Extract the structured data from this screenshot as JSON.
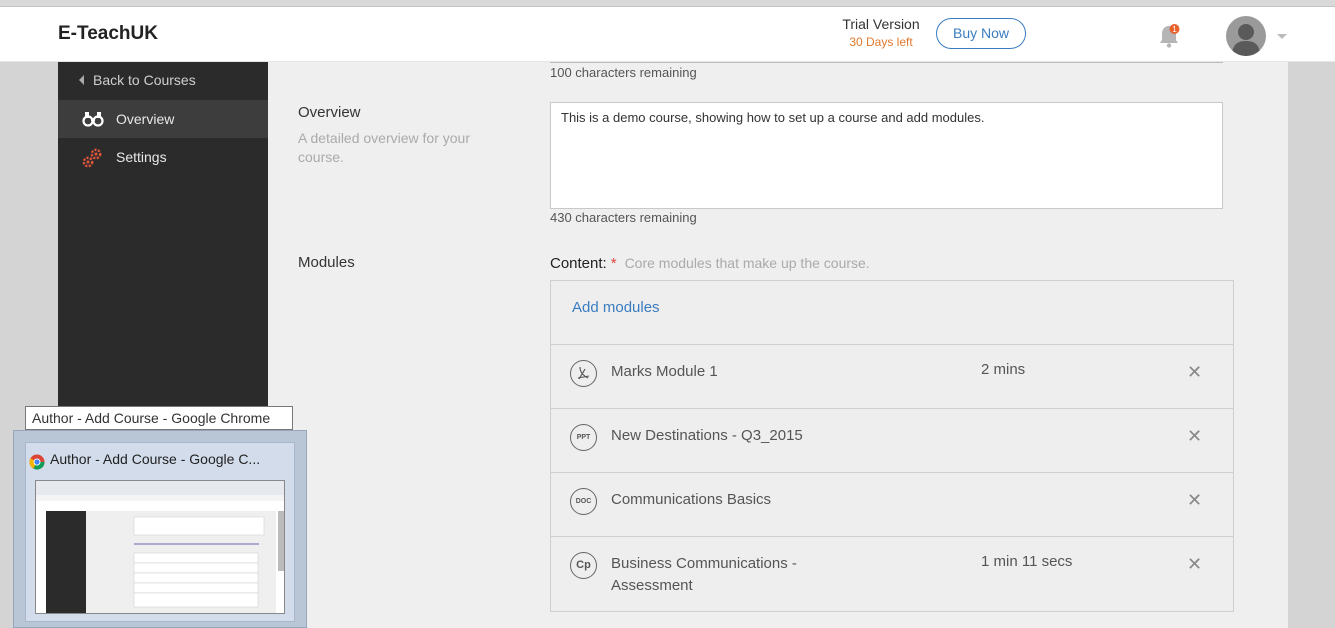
{
  "header": {
    "brand": "E-TeachUK",
    "trial_title": "Trial Version",
    "trial_days": "30 Days left",
    "buy_label": "Buy Now",
    "notification_count": "1"
  },
  "sidebar": {
    "back_label": "Back to Courses",
    "items": [
      {
        "label": "Overview",
        "icon": "binoculars-icon"
      },
      {
        "label": "Settings",
        "icon": "gears-icon"
      }
    ]
  },
  "form": {
    "title_remaining": "100 characters remaining",
    "overview_label": "Overview",
    "overview_desc": "A detailed overview for your course.",
    "overview_value": "This is a demo course, showing how to set up a course and add modules.",
    "overview_remaining": "430 characters remaining",
    "modules_label": "Modules",
    "content_label": "Content:",
    "content_required": "*",
    "content_hint": "Core modules that make up the course.",
    "add_modules": "Add modules",
    "modules": [
      {
        "icon_text": "",
        "icon": "pdf-icon",
        "name": "Marks Module 1",
        "duration": "2 mins"
      },
      {
        "icon_text": "PPT",
        "icon": "ppt-icon",
        "name": "New Destinations - Q3_2015",
        "duration": ""
      },
      {
        "icon_text": "DOC",
        "icon": "doc-icon",
        "name": "Communications Basics",
        "duration": ""
      },
      {
        "icon_text": "Cp",
        "icon": "captivate-icon",
        "name": "Business Communications - Assessment",
        "duration": "1 min 11 secs"
      }
    ],
    "remove_symbol": "✕"
  },
  "taskbar": {
    "tooltip": "Author - Add Course - Google Chrome",
    "thumb_title": "Author - Add Course - Google C..."
  },
  "colors": {
    "accent": "#3a7cc0",
    "trial_orange": "#e07a2e",
    "sidebar_bg": "#2b2b2b",
    "required_red": "#e0443c"
  }
}
